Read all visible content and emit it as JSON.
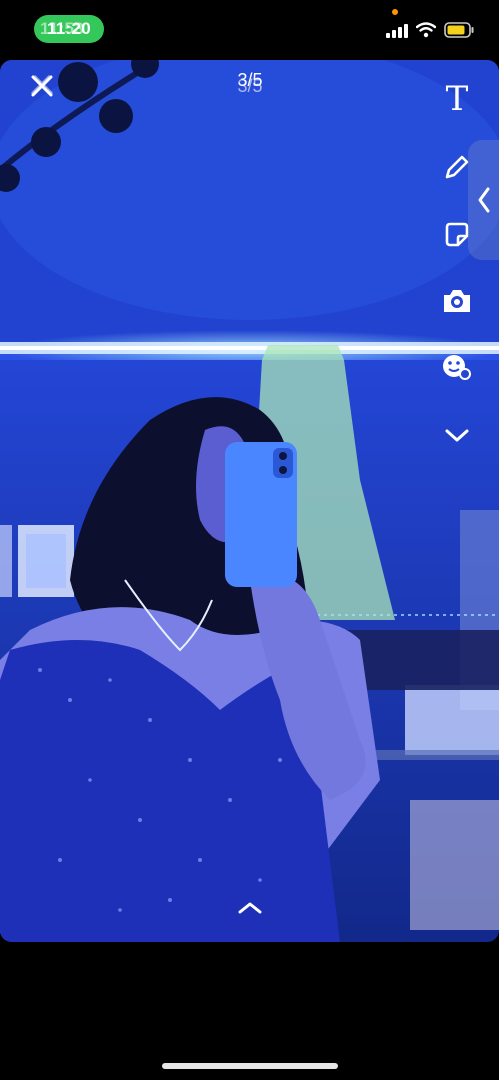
{
  "status_bar": {
    "time": "11:20",
    "time_ghost": "11:53",
    "pill_color": "#34c759",
    "recording_dot_color": "#ff9500",
    "icons": [
      "signal-icon",
      "wifi-icon",
      "battery-icon"
    ]
  },
  "story": {
    "counter": "3/5",
    "counter_ghost": "3/5",
    "close_icon": "close-icon",
    "tools": [
      "text-tool-icon",
      "pencil-icon",
      "sticker-icon",
      "camera-lens-icon",
      "emoji-effect-icon",
      "chevron-down-icon"
    ],
    "text_tool_label": "T",
    "side_tab_icon": "chevron-left-icon",
    "swipe_icon": "chevron-up-icon"
  },
  "colors": {
    "led_strip": "#bfe6ff",
    "phone_case": "#4a86ff",
    "dress": "#1e2fb8"
  }
}
